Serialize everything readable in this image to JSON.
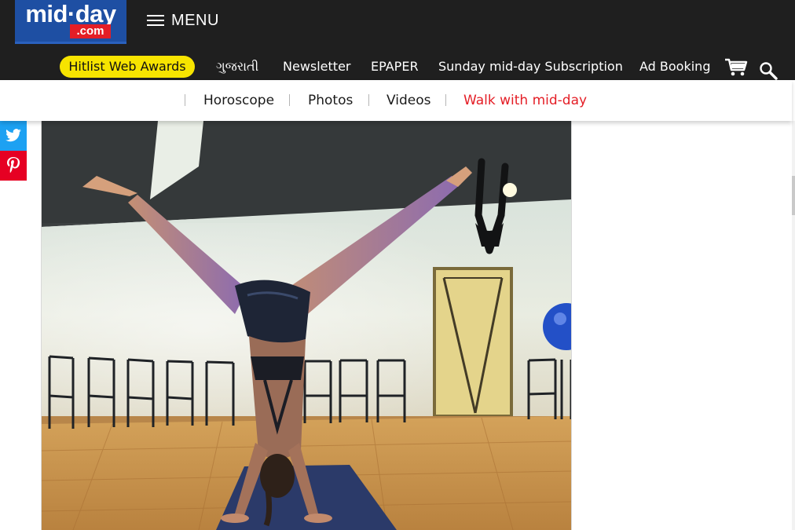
{
  "header": {
    "logo_top": "mid·day",
    "logo_bottom": ".com",
    "menu_label": "MENU"
  },
  "nav": {
    "highlight": "Hitlist Web Awards",
    "items": [
      "ગુજરાતી",
      "Newsletter",
      "EPAPER",
      "Sunday mid-day Subscription",
      "Ad Booking"
    ],
    "cart_icon": "cart-icon",
    "search_icon": "search-icon"
  },
  "subnav": {
    "items": [
      "Horoscope",
      "Photos",
      "Videos",
      "Walk with mid-day"
    ],
    "active_color": "#e41e26"
  },
  "share": {
    "items": [
      "twitter-icon",
      "pinterest-icon"
    ]
  },
  "colors": {
    "header_bg": "#1f1f1f",
    "logo_blue": "#1e4fa3",
    "logo_red": "#e41e26",
    "pill_yellow": "#f7e400",
    "twitter": "#1da1f2",
    "pinterest": "#e60023"
  }
}
